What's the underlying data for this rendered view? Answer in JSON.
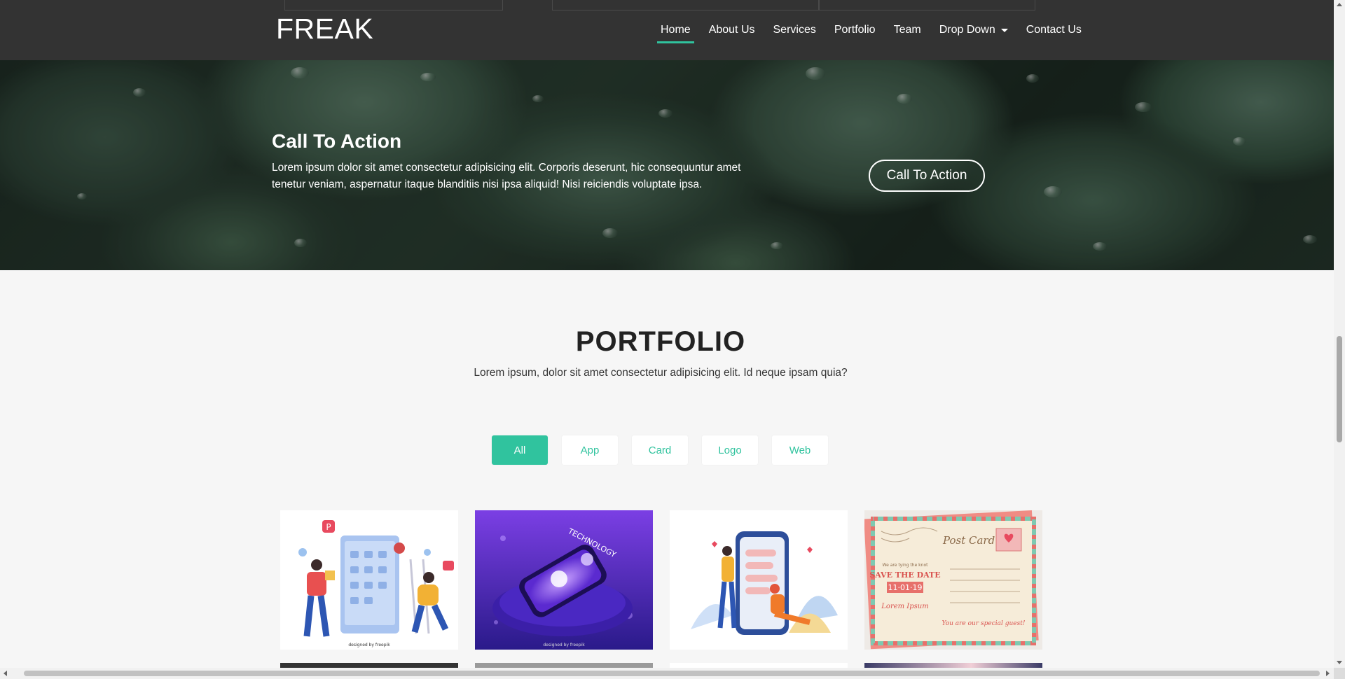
{
  "brand": "FREAK",
  "nav": {
    "items": [
      {
        "label": "Home",
        "active": true
      },
      {
        "label": "About Us"
      },
      {
        "label": "Services"
      },
      {
        "label": "Portfolio"
      },
      {
        "label": "Team"
      },
      {
        "label": "Drop Down",
        "has_caret": true
      },
      {
        "label": "Contact Us"
      }
    ]
  },
  "cta": {
    "title": "Call To Action",
    "text": "Lorem ipsum dolor sit amet consectetur adipisicing elit. Corporis deserunt, hic consequuntur amet tenetur veniam, aspernatur itaque blanditiis nisi ipsa aliquid! Nisi reiciendis voluptate ipsa.",
    "button": "Call To Action"
  },
  "portfolio": {
    "title": "PORTFOLIO",
    "subtitle": "Lorem ipsum, dolor sit amet consectetur adipisicing elit. Id neque ipsam quia?",
    "filters": [
      {
        "label": "All",
        "active": true
      },
      {
        "label": "App"
      },
      {
        "label": "Card"
      },
      {
        "label": "Logo"
      },
      {
        "label": "Web"
      }
    ],
    "cards": [
      {
        "name": "app-illustration-card",
        "credit": "designed by freepik"
      },
      {
        "name": "technology-phone-card",
        "title": "TECHNOLOGY",
        "credit": "designed by freepik"
      },
      {
        "name": "chat-phone-card"
      },
      {
        "name": "postcard-card",
        "heading": "Post Card",
        "lines": [
          "We are tying the knot",
          "SAVE THE DATE",
          "11·01·19",
          "Lorem Ipsum",
          "You are our special guest!"
        ]
      }
    ]
  },
  "colors": {
    "accent": "#30c39e",
    "navbar": "#333333",
    "page_bg": "#f6f6f6"
  }
}
